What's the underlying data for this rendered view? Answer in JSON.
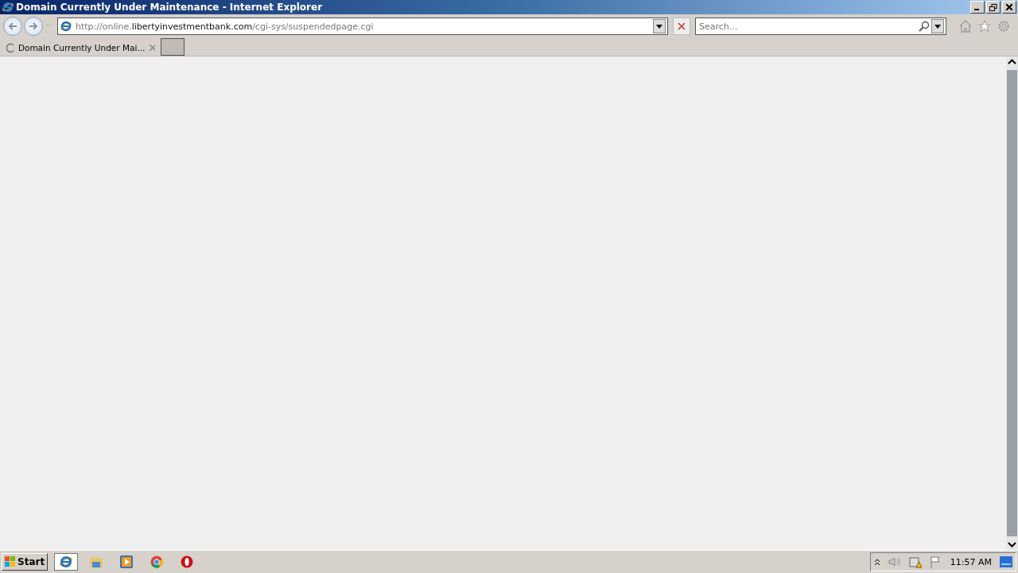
{
  "window": {
    "title": "Domain Currently Under Maintenance - Internet Explorer"
  },
  "address": {
    "prefix": "http://online.",
    "host": "libertyinvestmentbank.com",
    "path": "/cgi-sys/suspendedpage.cgi"
  },
  "search": {
    "placeholder": "Search..."
  },
  "tabs": [
    {
      "label": "Domain Currently Under Mai...",
      "selected": true,
      "loading": true
    }
  ],
  "taskbar": {
    "start": "Start",
    "apps": [
      {
        "kind": "ie",
        "selected": true
      },
      {
        "kind": "folder",
        "selected": false
      },
      {
        "kind": "media",
        "selected": false
      },
      {
        "kind": "chrome",
        "selected": false
      },
      {
        "kind": "opera",
        "selected": false
      }
    ],
    "clock": "11:57 AM"
  }
}
